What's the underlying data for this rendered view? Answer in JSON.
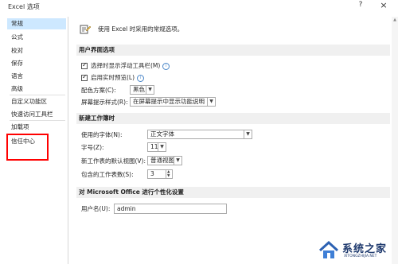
{
  "window": {
    "title": "Excel 选项",
    "help_label": "?",
    "close_label": "×"
  },
  "sidebar": {
    "items": [
      {
        "label": "常规"
      },
      {
        "label": "公式"
      },
      {
        "label": "校对"
      },
      {
        "label": "保存"
      },
      {
        "label": "语言"
      },
      {
        "label": "高级"
      },
      {
        "label": "自定义功能区"
      },
      {
        "label": "快速访问工具栏"
      },
      {
        "label": "加载项"
      },
      {
        "label": "信任中心"
      }
    ]
  },
  "header": {
    "text": "使用 Excel 时采用的常规选项。"
  },
  "ui_section": {
    "title": "用户界面选项",
    "mini_toolbar_label": "选择时显示浮动工具栏(M)",
    "live_preview_label": "启用实时预览(L)",
    "color_scheme_label": "配色方案(C):",
    "color_scheme_value": "黑色",
    "tooltip_style_label": "屏幕提示样式(R):",
    "tooltip_style_value": "在屏幕提示中显示功能说明"
  },
  "new_workbook_section": {
    "title": "新建工作簿时",
    "font_label": "使用的字体(N):",
    "font_value": "正文字体",
    "size_label": "字号(Z):",
    "size_value": "11",
    "view_label": "新工作表的默认视图(V):",
    "view_value": "普通视图",
    "sheets_label": "包含的工作表数(S):",
    "sheets_value": "3"
  },
  "personalize_section": {
    "title": "对 Microsoft Office 进行个性化设置",
    "username_label": "用户名(U):",
    "username_value": "admin"
  },
  "watermark": {
    "brand": "系统之家",
    "url": "XITONGZHIJIA.NET"
  }
}
